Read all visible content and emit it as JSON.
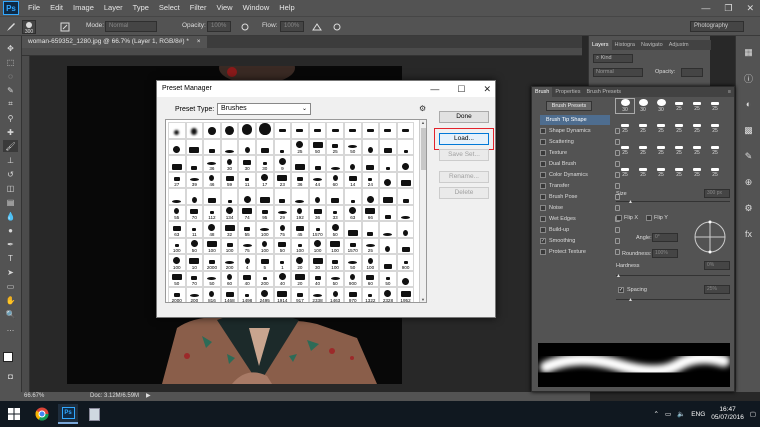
{
  "app": {
    "logo_text": "Ps"
  },
  "menu": [
    "File",
    "Edit",
    "Image",
    "Layer",
    "Type",
    "Select",
    "Filter",
    "View",
    "Window",
    "Help"
  ],
  "window_controls": {
    "minimize": "—",
    "restore": "❐",
    "close": "✕"
  },
  "options_bar": {
    "brush_size": "300",
    "mode_label": "Mode:",
    "mode_value": "Normal",
    "opacity_label": "Opacity:",
    "opacity_value": "100%",
    "flow_label": "Flow:",
    "flow_value": "100%",
    "workspace": "Photography"
  },
  "document_tab": {
    "title": "woman-659352_1280.jpg @ 66.7% (Layer 1, RGB/8#) *",
    "close": "×"
  },
  "status_bar": {
    "zoom": "66.67%",
    "doc": "Doc: 3.12M/6.59M"
  },
  "right_panel": {
    "tabs": [
      "Layers",
      "Histogra",
      "Navigato",
      "Adjustm"
    ],
    "kind": "Kind",
    "blend": "Normal",
    "opacity_label": "Opacity:"
  },
  "brush_panel": {
    "tabs": [
      "Brush",
      "Properties",
      "Brush Presets"
    ],
    "presets_button": "Brush Presets",
    "options": [
      {
        "label": "Brush Tip Shape",
        "checkbox": false,
        "selected": true
      },
      {
        "label": "Shape Dynamics",
        "checkbox": true,
        "checked": false
      },
      {
        "label": "Scattering",
        "checkbox": true,
        "checked": false
      },
      {
        "label": "Texture",
        "checkbox": true,
        "checked": false
      },
      {
        "label": "Dual Brush",
        "checkbox": true,
        "checked": false
      },
      {
        "label": "Color Dynamics",
        "checkbox": true,
        "checked": false
      },
      {
        "label": "Transfer",
        "checkbox": true,
        "checked": false
      },
      {
        "label": "Brush Pose",
        "checkbox": true,
        "checked": false
      },
      {
        "label": "Noise",
        "checkbox": true,
        "checked": false
      },
      {
        "label": "Wet Edges",
        "checkbox": true,
        "checked": false
      },
      {
        "label": "Build-up",
        "checkbox": true,
        "checked": false
      },
      {
        "label": "Smoothing",
        "checkbox": true,
        "checked": true
      },
      {
        "label": "Protect Texture",
        "checkbox": true,
        "checked": false
      }
    ],
    "tip_numbers": [
      "30",
      "30",
      "30",
      "25",
      "25",
      "25",
      "25",
      "25",
      "25",
      "25",
      "25",
      "25",
      "25",
      "25",
      "25",
      "25",
      "25",
      "25",
      "25",
      "25",
      "25",
      "25",
      "25",
      "25"
    ],
    "size_label": "Size",
    "size_value": "300 px",
    "flip_x": "Flip X",
    "flip_y": "Flip Y",
    "angle_label": "Angle:",
    "angle_value": "0°",
    "roundness_label": "Roundness:",
    "roundness_value": "100%",
    "hardness_label": "Hardness",
    "hardness_value": "0%",
    "spacing_label": "Spacing",
    "spacing_value": "25%"
  },
  "dialog": {
    "title": "Preset Manager",
    "preset_type_label": "Preset Type:",
    "preset_type_value": "Brushes",
    "buttons": {
      "done": "Done",
      "load": "Load...",
      "save_set": "Save Set...",
      "rename": "Rename...",
      "delete": "Delete"
    },
    "numbers": [
      "",
      "",
      "",
      "",
      "",
      "",
      "",
      "",
      "",
      "",
      "",
      "",
      "",
      "",
      "",
      "",
      "",
      "",
      "",
      "",
      "",
      "25",
      "50",
      "25",
      "50",
      "",
      "",
      "",
      "",
      "",
      "36",
      "30",
      "30",
      "30",
      "9",
      "",
      "",
      "",
      "",
      "",
      "",
      "",
      "27",
      "39",
      "46",
      "59",
      "11",
      "17",
      "23",
      "36",
      "44",
      "60",
      "14",
      "24",
      "",
      "",
      "",
      "",
      "",
      "",
      "",
      "",
      "",
      "",
      "",
      "",
      "",
      "",
      "",
      "",
      "55",
      "70",
      "112",
      "134",
      "74",
      "95",
      "29",
      "192",
      "36",
      "33",
      "63",
      "66",
      "",
      "",
      "63",
      "11",
      "48",
      "32",
      "55",
      "100",
      "75",
      "45",
      "1570",
      "50",
      "",
      "",
      "",
      "",
      "100",
      "50",
      "100",
      "100",
      "75",
      "100",
      "50",
      "100",
      "100",
      "100",
      "1570",
      "25",
      "",
      ""
    ],
    "row8": [
      "100",
      "10",
      "2000",
      "200",
      "4",
      "5",
      "1",
      "20",
      "30",
      "100",
      "50",
      "100",
      "",
      "900"
    ],
    "row9": [
      "50",
      "70",
      "50",
      "60",
      "40",
      "200",
      "40",
      "20",
      "40",
      "50",
      "900",
      "60",
      "50",
      ""
    ],
    "row10": [
      "2000",
      "200",
      "816",
      "1468",
      "1498",
      "2495",
      "1914",
      "917",
      "2338",
      "1463",
      "970",
      "1322",
      "2328",
      "1952"
    ]
  },
  "taskbar": {
    "lang": "ENG",
    "time": "16:47",
    "date": "05/07/2016"
  },
  "colors": {
    "accent_red": "#e3222b",
    "ps_blue": "#31a8ff"
  }
}
